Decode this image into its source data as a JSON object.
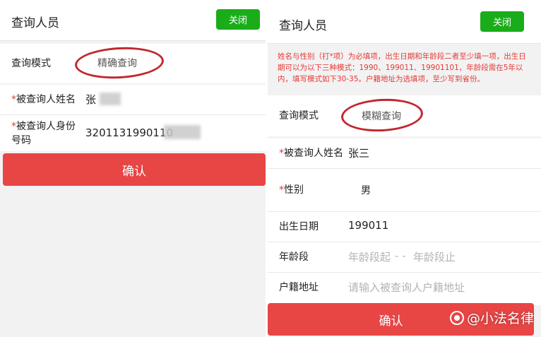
{
  "left": {
    "title": "查询人员",
    "close_label": "关闭",
    "mode_label": "查询模式",
    "mode_value": "精确查询",
    "name_label": "被查询人姓名",
    "name_value": "张",
    "id_label": "被查询人身份号码",
    "id_value": "3201131990110",
    "confirm_label": "确认"
  },
  "right": {
    "title": "查询人员",
    "close_label": "关闭",
    "notice": "姓名与性别（打*项）为必填项，出生日期和年龄段二者至少填一项，出生日期可以为以下三种模式：1990、199011、19901101，年龄段需在5年以内，填写模式如下30-35。户籍地址为选填项，至少写到省份。",
    "mode_label": "查询模式",
    "mode_value": "模糊查询",
    "name_label": "被查询人姓名",
    "name_value": "张三",
    "gender_label": "性别",
    "gender_value": "男",
    "birth_label": "出生日期",
    "birth_value": "199011",
    "age_label": "年龄段",
    "age_start_placeholder": "年龄段起",
    "age_sep": "- -",
    "age_end_placeholder": "年龄段止",
    "address_label": "户籍地址",
    "address_placeholder": "请输入被查询人户籍地址",
    "confirm_label": "确认"
  },
  "required_mark": "*",
  "watermark": "@小法名律",
  "colors": {
    "close_green": "#1aad19",
    "confirm_red": "#e84545",
    "annotation_red": "#c0282f",
    "notice_red": "#e53935"
  }
}
